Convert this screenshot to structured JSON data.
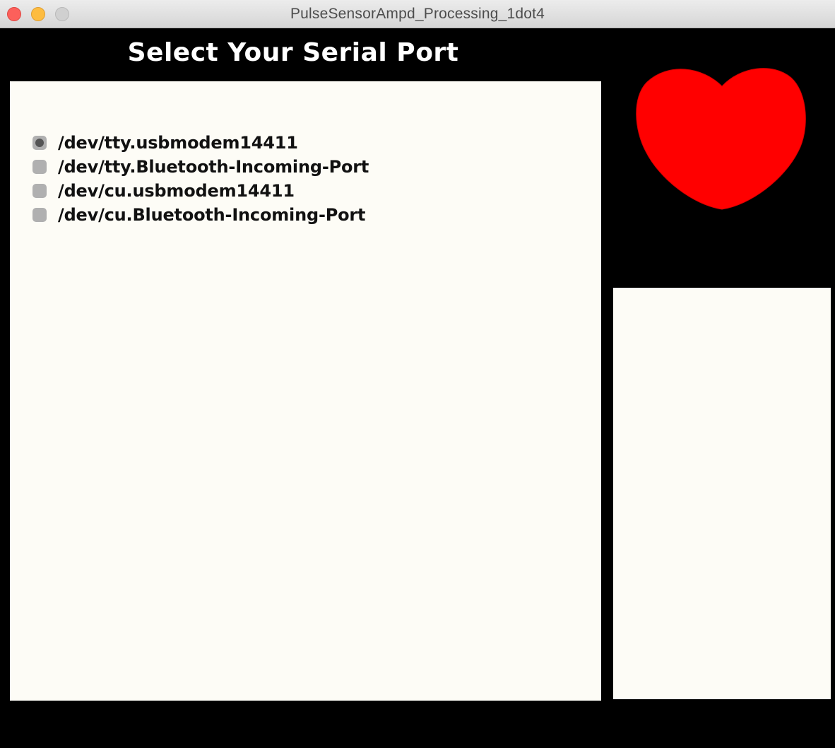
{
  "window": {
    "title": "PulseSensorAmpd_Processing_1dot4"
  },
  "heading": "Select Your Serial Port",
  "ports": [
    {
      "label": "/dev/tty.usbmodem14411",
      "selected": true
    },
    {
      "label": "/dev/tty.Bluetooth-Incoming-Port",
      "selected": false
    },
    {
      "label": "/dev/cu.usbmodem14411",
      "selected": false
    },
    {
      "label": "/dev/cu.Bluetooth-Incoming-Port",
      "selected": false
    }
  ],
  "colors": {
    "background": "#000000",
    "panel": "#fdfcf6",
    "heart": "#ff0000",
    "radio": "#b0b0b0",
    "radio_selected_dot": "#555555"
  },
  "icons": {
    "heart": "heart-icon"
  }
}
